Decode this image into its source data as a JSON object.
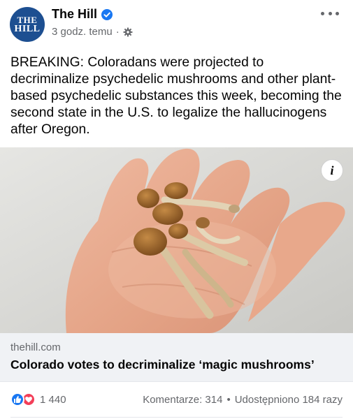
{
  "post": {
    "page": {
      "avatar_line1": "THE",
      "avatar_line2": "HILL",
      "name": "The Hill",
      "verified": true,
      "timestamp": "3 godz. temu",
      "separator": "·",
      "audience_icon": "gear-icon"
    },
    "more_icon": "more-horizontal-icon",
    "text": "BREAKING: Coloradans were projected to decriminalize psychedelic mushrooms and other plant-based psychedelic substances this week, becoming the second state in the U.S. to legalize the hallucinogens after Oregon.",
    "media": {
      "subject": "hand-holding-mushrooms-image",
      "info_icon": "i"
    },
    "link": {
      "domain": "thehill.com",
      "title": "Colorado votes to decriminalize ‘magic mushrooms’"
    },
    "engagement": {
      "reaction_icons": [
        "like-icon",
        "love-icon"
      ],
      "reaction_count": "1 440",
      "comments": "Komentarze: 314",
      "bullet": "•",
      "shares": "Udostępniono 184 razy"
    },
    "colors": {
      "brand_blue": "#1d4f91",
      "verified_blue": "#1877f2",
      "love_red": "#f33e58",
      "secondary_text": "#65676b",
      "link_card_bg": "#f0f2f5"
    }
  }
}
